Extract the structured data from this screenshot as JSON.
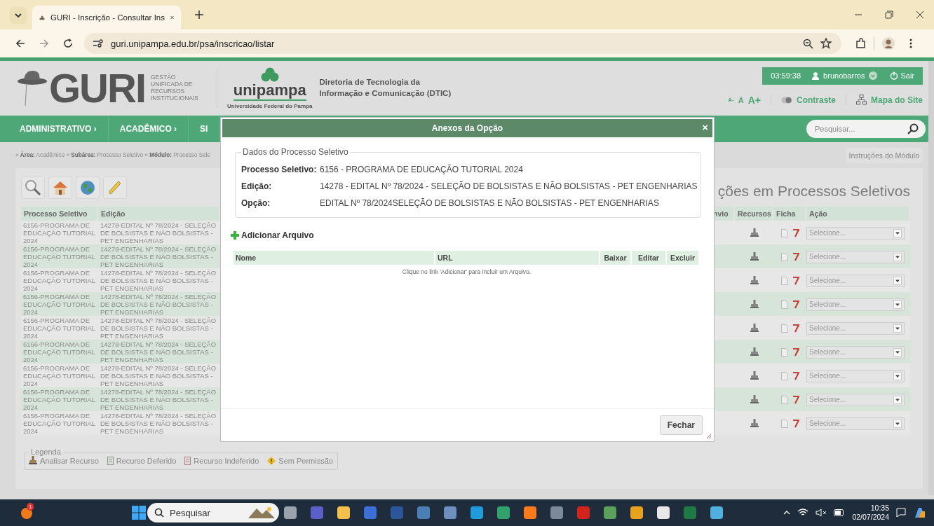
{
  "browser": {
    "tab_title": "GURI - Inscrição - Consultar Ins",
    "url": "guri.unipampa.edu.br/psa/inscricao/listar"
  },
  "header": {
    "guri": "GURI",
    "guri_subtitle": "GESTÃO UNIFICADA DE RECURSOS INSTITUCIONAIS",
    "unipampa": "unipampa",
    "unipampa_subtitle": "Universidade Federal do Pampa",
    "dtic": "Diretoria de Tecnologia da Informação e Comunicação (DTIC)",
    "session": {
      "time": "03:59:38",
      "user": "brunobarros",
      "logout": "Sair"
    },
    "font_sizes": [
      "A-",
      "A",
      "A+"
    ],
    "contrast": "Contraste",
    "site_map": "Mapa do Site"
  },
  "nav": {
    "items": [
      "ADMINISTRATIVO ›",
      "ACADÊMICO ›",
      "SI"
    ],
    "search": {
      "placeholder": "Pesquisar..."
    }
  },
  "breadcrumb": "» **Área:** Acadêmico » **Subárea:** Processo Seletivo » **Módulo:** Processo Sele",
  "instructions": "Instruções do Módulo",
  "page_title": "ções em Processos Seletivos",
  "table": {
    "columns_left": [
      "Processo Seletivo",
      "Edição"
    ],
    "columns_right": [
      "nvio",
      "Recursos",
      "Ficha",
      "Ação"
    ],
    "rows": [
      {
        "process": "6156-PROGRAMA DE EDUCAÇÃO TUTORIAL 2024",
        "edition": "14278-EDITAL Nº 78/2024 - SELEÇÃO DE BOLSISTAS E NÃO BOLSISTAS - PET ENGENHARIAS",
        "action": "Selecione..."
      },
      {
        "process": "6156-PROGRAMA DE EDUCAÇÃO TUTORIAL 2024",
        "edition": "14278-EDITAL Nº 78/2024 - SELEÇÃO DE BOLSISTAS E NÃO BOLSISTAS - PET ENGENHARIAS",
        "action": "Selecione..."
      },
      {
        "process": "6156-PROGRAMA DE EDUCAÇÃO TUTORIAL 2024",
        "edition": "14278-EDITAL Nº 78/2024 - SELEÇÃO DE BOLSISTAS E NÃO BOLSISTAS - PET ENGENHARIAS",
        "action": "Selecione..."
      },
      {
        "process": "6156-PROGRAMA DE EDUCAÇÃO TUTORIAL 2024",
        "edition": "14278-EDITAL Nº 78/2024 - SELEÇÃO DE BOLSISTAS E NÃO BOLSISTAS - PET ENGENHARIAS",
        "action": "Selecione..."
      },
      {
        "process": "6156-PROGRAMA DE EDUCAÇÃO TUTORIAL 2024",
        "edition": "14278-EDITAL Nº 78/2024 - SELEÇÃO DE BOLSISTAS E NÃO BOLSISTAS - PET ENGENHARIAS",
        "action": "Selecione..."
      },
      {
        "process": "6156-PROGRAMA DE EDUCAÇÃO TUTORIAL 2024",
        "edition": "14278-EDITAL Nº 78/2024 - SELEÇÃO DE BOLSISTAS E NÃO BOLSISTAS - PET ENGENHARIAS",
        "action": "Selecione..."
      },
      {
        "process": "6156-PROGRAMA DE EDUCAÇÃO TUTORIAL 2024",
        "edition": "14278-EDITAL Nº 78/2024 - SELEÇÃO DE BOLSISTAS E NÃO BOLSISTAS - PET ENGENHARIAS",
        "action": "Selecione..."
      },
      {
        "process": "6156-PROGRAMA DE EDUCAÇÃO TUTORIAL 2024",
        "edition": "14278-EDITAL Nº 78/2024 - SELEÇÃO DE BOLSISTAS E NÃO BOLSISTAS - PET ENGENHARIAS",
        "action": "Selecione..."
      },
      {
        "process": "6156-PROGRAMA DE EDUCAÇÃO TUTORIAL 2024",
        "edition": "14278-EDITAL Nº 78/2024 - SELEÇÃO DE BOLSISTAS E NÃO BOLSISTAS - PET ENGENHARIAS",
        "action": "Selecione..."
      }
    ]
  },
  "legend": {
    "title": "Legenda",
    "items": [
      {
        "kind": "analyze",
        "label": "Analisar Recurso"
      },
      {
        "kind": "granted",
        "label": "Recurso Deferido"
      },
      {
        "kind": "denied",
        "label": "Recurso Indeferido"
      },
      {
        "kind": "forbidden",
        "label": "Sem Permissão"
      }
    ]
  },
  "modal": {
    "title": "Anexos da Opção",
    "close": "×",
    "fieldset_title": "Dados do Processo Seletivo",
    "fields": [
      {
        "label": "Processo Seletivo:",
        "value": "6156 - PROGRAMA DE EDUCAÇÃO TUTORIAL 2024"
      },
      {
        "label": "Edição:",
        "value": "14278 - EDITAL Nº 78/2024 - SELEÇÃO DE BOLSISTAS E NÃO BOLSISTAS - PET ENGENHARIAS"
      },
      {
        "label": "Opção:",
        "value": "EDITAL Nº 78/2024SELEÇÃO DE BOLSISTAS E NÃO BOLSISTAS - PET ENGENHARIAS"
      }
    ],
    "add_file": "Adicionar Arquivo",
    "columns": [
      "Nome",
      "URL",
      "Baixar",
      "Editar",
      "Excluir"
    ],
    "empty_message": "Clique no link 'Adicionar' para incluir um Arquivo.",
    "close_button": "Fechar"
  },
  "taskbar": {
    "notification_count": "1",
    "search": {
      "placeholder": "Pesquisar"
    },
    "time": "10:35",
    "date": "02/07/2024"
  }
}
